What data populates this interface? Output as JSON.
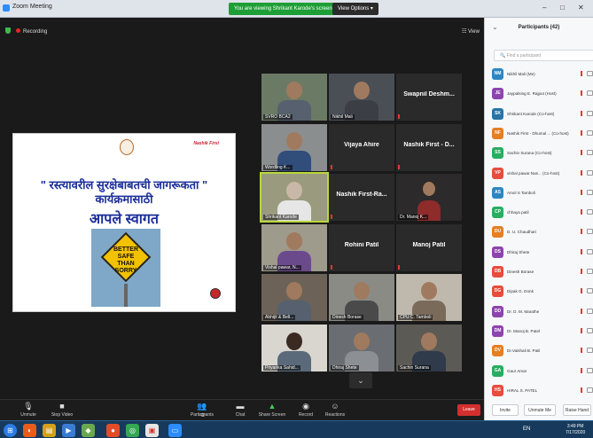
{
  "window": {
    "title": "Zoom Meeting",
    "controls": [
      "–",
      "□",
      "✕"
    ]
  },
  "banner": {
    "viewing": "You are viewing Shrikant Karode's screen",
    "view_options": "View Options ▾"
  },
  "top": {
    "recording": "Recording",
    "view": "View"
  },
  "share": {
    "line1": "\" रस्त्यावरील सुरक्षेबाबतची जागरूकता \"",
    "line2": "कार्यक्रमासाठी",
    "line3": "आपले स्वागत",
    "brand": "Nashik First",
    "sign_text": "BETTER SAFE THAN SORRY"
  },
  "tiles": [
    {
      "name": "SVRO BCA2",
      "label": "",
      "video": true
    },
    {
      "name": "Nikhil Mali",
      "label": "",
      "video": true
    },
    {
      "name": "",
      "label": "Swapnil Deshm...",
      "video": false
    },
    {
      "name": "Wordling K...",
      "label": "",
      "video": true
    },
    {
      "name": "",
      "label": "Vijaya Ahire",
      "video": false
    },
    {
      "name": "",
      "label": "Nashik First - D...",
      "video": false
    },
    {
      "name": "Shrikant Karode",
      "label": "",
      "video": true,
      "active": true
    },
    {
      "name": "",
      "label": "Nashik First-Ra...",
      "video": false
    },
    {
      "name": "Dr. Manoj K...",
      "label": "",
      "video": true
    },
    {
      "name": "Vishal pawar, N...",
      "label": "",
      "video": true
    },
    {
      "name": "",
      "label": "Rohini Patil",
      "video": false
    },
    {
      "name": "",
      "label": "Manoj Patil",
      "video": false
    },
    {
      "name": "Abhijit & Bell...",
      "label": "",
      "video": true
    },
    {
      "name": "Dinesh Borase",
      "label": "",
      "video": true
    },
    {
      "name": "CPU C. Tamboli",
      "label": "",
      "video": true
    },
    {
      "name": "Priyanka Sahid...",
      "label": "",
      "video": true
    },
    {
      "name": "Dhiraj Shete",
      "label": "",
      "video": true
    },
    {
      "name": "Sachin Surana",
      "label": "",
      "video": true
    }
  ],
  "toolbar": {
    "unmute": "Unmute",
    "stop_video": "Stop Video",
    "participants": "Participants",
    "participants_count": "42",
    "chat": "Chat",
    "share_screen": "Share Screen",
    "record": "Record",
    "reactions": "Reactions",
    "leave": "Leave"
  },
  "panel": {
    "title": "Participants (42)",
    "search_placeholder": "Find a participant",
    "participants": [
      {
        "initials": "NM",
        "name": "Nikhil Mali (Me)",
        "color": "#2e86c1"
      },
      {
        "initials": "JE",
        "name": "Jaypalsing E. Rajput (Host)",
        "color": "#8e44ad"
      },
      {
        "initials": "SK",
        "name": "Shrikant Karode (Co-host)",
        "color": "#2874a6"
      },
      {
        "initials": "NF",
        "name": "Nashik First - Dhumal ... (Co-host)",
        "color": "#e67e22"
      },
      {
        "initials": "SS",
        "name": "Sachin Surana (Co-host)",
        "color": "#27ae60"
      },
      {
        "initials": "VP",
        "name": "vishal pawar Nas... (Co-host)",
        "color": "#e74c3c"
      },
      {
        "initials": "AS",
        "name": "Amol S Tamboli",
        "color": "#2e86c1"
      },
      {
        "initials": "CP",
        "name": "chhaya patil",
        "color": "#27ae60"
      },
      {
        "initials": "DU",
        "name": "D. U. Chaudhari",
        "color": "#e67e22"
      },
      {
        "initials": "DS",
        "name": "Dhiraj Shete",
        "color": "#8e44ad"
      },
      {
        "initials": "DB",
        "name": "Dinesh Borase",
        "color": "#e74c3c"
      },
      {
        "initials": "DG",
        "name": "Dipak G. Donk",
        "color": "#e74c3c"
      },
      {
        "initials": "DD",
        "name": "Dr. D. M. Marathe",
        "color": "#8e44ad"
      },
      {
        "initials": "DM",
        "name": "Dr. Manoj B. Patel",
        "color": "#8e44ad"
      },
      {
        "initials": "DV",
        "name": "Dr.Vaishali B. Patil",
        "color": "#e67e22"
      },
      {
        "initials": "GA",
        "name": "Gaur Amar",
        "color": "#27ae60"
      },
      {
        "initials": "HS",
        "name": "HIRAL S. PATEL",
        "color": "#e74c3c"
      }
    ],
    "invite": "Invite",
    "unmute_me": "Unmute Me",
    "raise_hand": "Raise Hand"
  },
  "taskbar": {
    "lang": "EN",
    "time": "3:49 PM",
    "date": "7/17/2020"
  }
}
